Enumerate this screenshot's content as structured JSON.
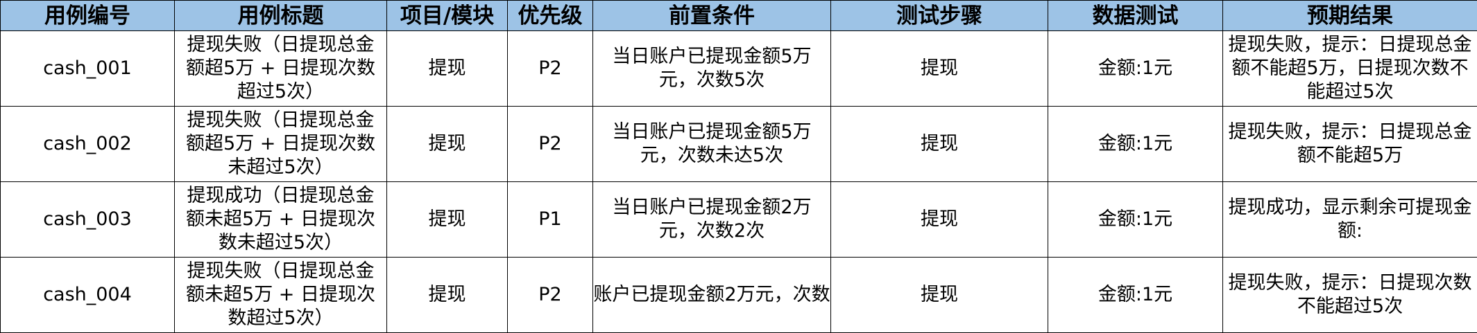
{
  "headers": [
    "用例编号",
    "用例标题",
    "项目/模块",
    "优先级",
    "前置条件",
    "测试步骤",
    "数据测试",
    "预期结果"
  ],
  "rows": [
    {
      "id": "cash_001",
      "title": "提现失败（日提现总金额超5万 + 日提现次数超过5次）",
      "module": "提现",
      "priority": "P2",
      "precondition": "当日账户已提现金额5万元，次数5次",
      "steps": "提现",
      "data": "金额:1元",
      "expected": "提现失败，提示：日提现总金额不能超5万，日提现次数不能超过5次"
    },
    {
      "id": "cash_002",
      "title": "提现失败（日提现总金额超5万 + 日提现次数未超过5次）",
      "module": "提现",
      "priority": "P2",
      "precondition": "当日账户已提现金额5万元，次数未达5次",
      "steps": "提现",
      "data": "金额:1元",
      "expected": "提现失败，提示：日提现总金额不能超5万"
    },
    {
      "id": "cash_003",
      "title": "提现成功（日提现总金额未超5万 + 日提现次数未超过5次）",
      "module": "提现",
      "priority": "P1",
      "precondition": "当日账户已提现金额2万元，次数2次",
      "steps": "提现",
      "data": "金额:1元",
      "expected": "提现成功，显示剩余可提现金额:"
    },
    {
      "id": "cash_004",
      "title": "提现失败（日提现总金额未超5万 + 日提现次数超过5次）",
      "module": "提现",
      "priority": "P2",
      "precondition": "账户已提现金额2万元，次数",
      "steps": "提现",
      "data": "金额:1元",
      "expected": "提现失败，提示：日提现次数不能超过5次"
    }
  ]
}
